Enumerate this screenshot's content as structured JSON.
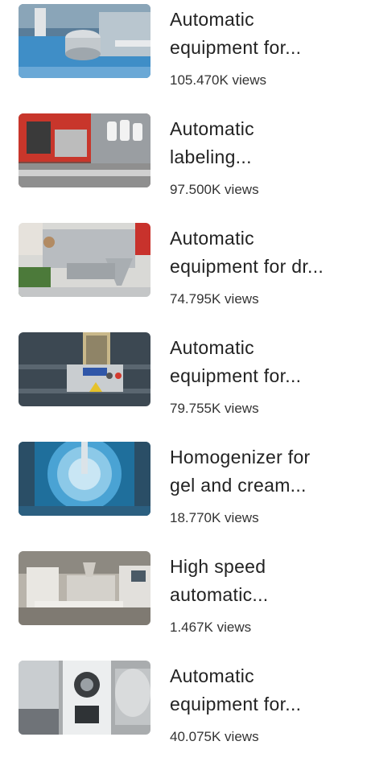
{
  "videos": [
    {
      "title_line1": "Automatic",
      "title_line2": "equipment for...",
      "views": "105.470K views",
      "thumb": "capping-machine-icon"
    },
    {
      "title_line1": "Automatic",
      "title_line2": "labeling...",
      "views": "97.500K views",
      "thumb": "labeling-machine-icon"
    },
    {
      "title_line1": "Automatic",
      "title_line2": "equipment for dr...",
      "views": "74.795K views",
      "thumb": "filling-machine-icon"
    },
    {
      "title_line1": "Automatic",
      "title_line2": "equipment for...",
      "views": "79.755K views",
      "thumb": "screw-feeder-icon"
    },
    {
      "title_line1": "Homogenizer for",
      "title_line2": "gel and cream...",
      "views": "18.770K views",
      "thumb": "homogenizer-icon"
    },
    {
      "title_line1": "High speed",
      "title_line2": "automatic...",
      "views": "1.467K views",
      "thumb": "packing-line-icon"
    },
    {
      "title_line1": "Automatic",
      "title_line2": "equipment for...",
      "views": "40.075K views",
      "thumb": "tablet-press-icon"
    }
  ]
}
